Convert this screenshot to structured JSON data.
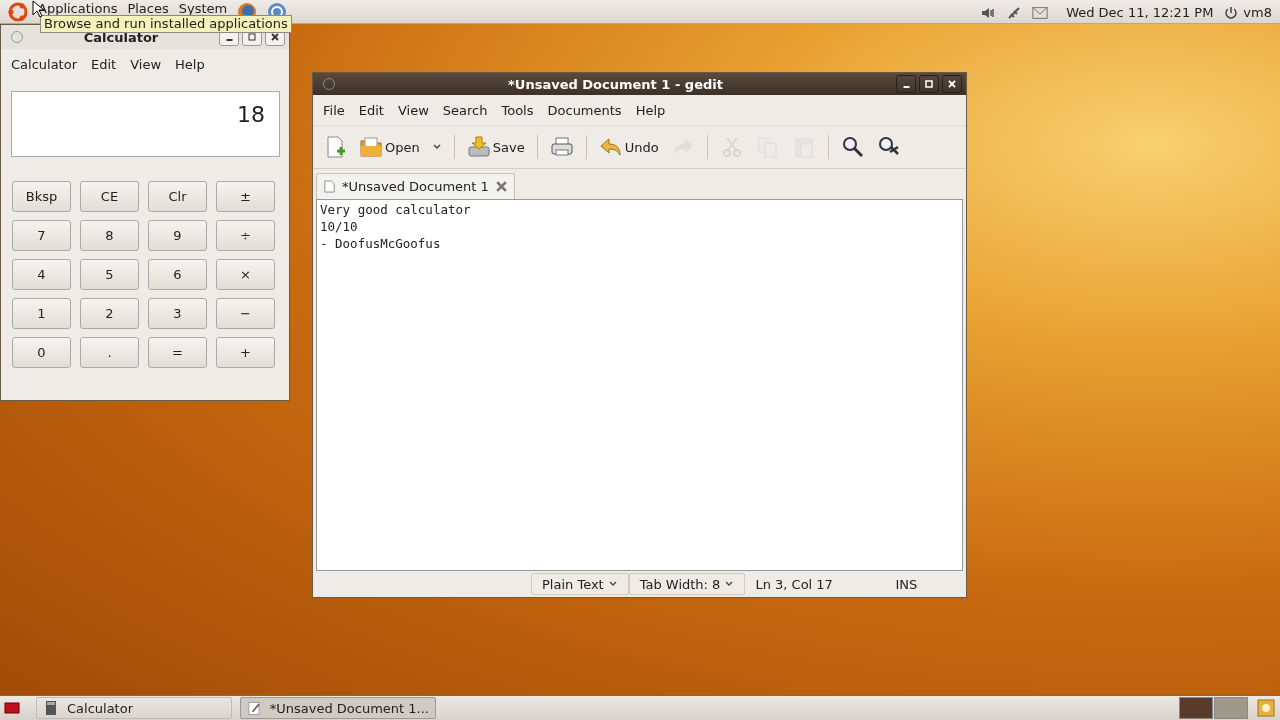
{
  "top_panel": {
    "menus": [
      "Applications",
      "Places",
      "System"
    ],
    "tooltip": "Browse and run installed applications",
    "clock": "Wed Dec 11, 12:21 PM",
    "user": "vm8"
  },
  "calculator": {
    "title": "Calculator",
    "menu": [
      "Calculator",
      "Edit",
      "View",
      "Help"
    ],
    "display": "18",
    "keys": [
      [
        "Bksp",
        "CE",
        "Clr",
        "±"
      ],
      [
        "7",
        "8",
        "9",
        "÷"
      ],
      [
        "4",
        "5",
        "6",
        "×"
      ],
      [
        "1",
        "2",
        "3",
        "−"
      ],
      [
        "0",
        ".",
        "=",
        "+"
      ]
    ]
  },
  "gedit": {
    "title": "*Unsaved Document 1 - gedit",
    "menu": [
      "File",
      "Edit",
      "View",
      "Search",
      "Tools",
      "Documents",
      "Help"
    ],
    "toolbar": [
      {
        "kind": "new",
        "disabled": false
      },
      {
        "kind": "open",
        "label": "Open",
        "disabled": false
      },
      {
        "kind": "dropdown",
        "disabled": false
      },
      {
        "kind": "sep"
      },
      {
        "kind": "save",
        "label": "Save",
        "disabled": false
      },
      {
        "kind": "sep"
      },
      {
        "kind": "print",
        "disabled": false
      },
      {
        "kind": "sep"
      },
      {
        "kind": "undo",
        "label": "Undo",
        "disabled": false
      },
      {
        "kind": "redo",
        "disabled": true
      },
      {
        "kind": "sep"
      },
      {
        "kind": "cut",
        "disabled": true
      },
      {
        "kind": "copy",
        "disabled": true
      },
      {
        "kind": "paste",
        "disabled": true
      },
      {
        "kind": "sep"
      },
      {
        "kind": "find",
        "disabled": false
      },
      {
        "kind": "replace",
        "disabled": false
      }
    ],
    "tab": {
      "label": "*Unsaved Document 1",
      "selected": true
    },
    "lines": [
      "Very good calculator",
      "10/10",
      "- DoofusMcGoofus"
    ],
    "status": {
      "language": "Plain Text",
      "tab_width": "Tab Width:  8",
      "position": "Ln 3, Col 17",
      "mode": "INS"
    }
  },
  "taskbar": {
    "tasks": [
      {
        "label": "Calculator",
        "kind": "calc",
        "selected": false
      },
      {
        "label": "*Unsaved Document 1...",
        "kind": "doc",
        "selected": true
      }
    ],
    "workspaces": [
      {
        "selected": true
      },
      {
        "selected": false
      }
    ]
  }
}
